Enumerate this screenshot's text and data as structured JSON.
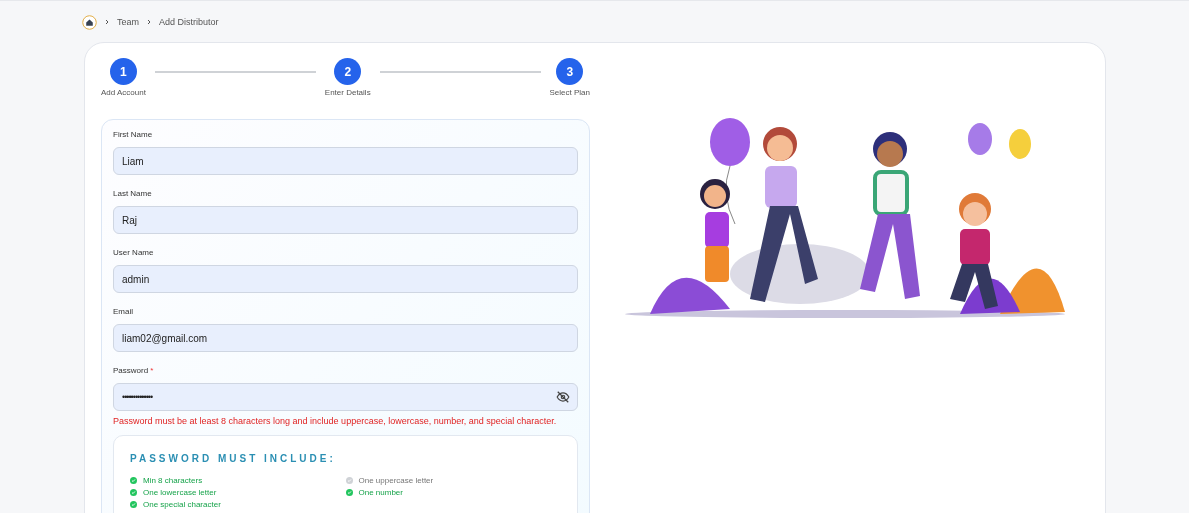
{
  "breadcrumb": [
    "Team",
    "Add Distributor"
  ],
  "steps": [
    {
      "number": "1",
      "label": "Add Account"
    },
    {
      "number": "2",
      "label": "Enter Details"
    },
    {
      "number": "3",
      "label": "Select Plan"
    }
  ],
  "fields": [
    {
      "label": "First Name",
      "value": "Liam",
      "kind": "text"
    },
    {
      "label": "Last Name",
      "value": "Raj",
      "kind": "text"
    },
    {
      "label": "User Name",
      "value": "admin",
      "kind": "text"
    },
    {
      "label": "Email",
      "value": "liam02@gmail.com",
      "kind": "text"
    },
    {
      "label": "Password",
      "required_mark": "*",
      "value": "••••••••••••••",
      "kind": "password"
    }
  ],
  "error": "Password must be at least 8 characters long and include uppercase, lowercase, number, and special character.",
  "requirements": {
    "title": "PASSWORD MUST INCLUDE:",
    "items": [
      {
        "label": "Min 8 characters",
        "met": true
      },
      {
        "label": "One uppercase letter",
        "met": false
      },
      {
        "label": "One lowercase letter",
        "met": true
      },
      {
        "label": "One number",
        "met": true
      },
      {
        "label": "One special character",
        "met": true
      }
    ]
  }
}
